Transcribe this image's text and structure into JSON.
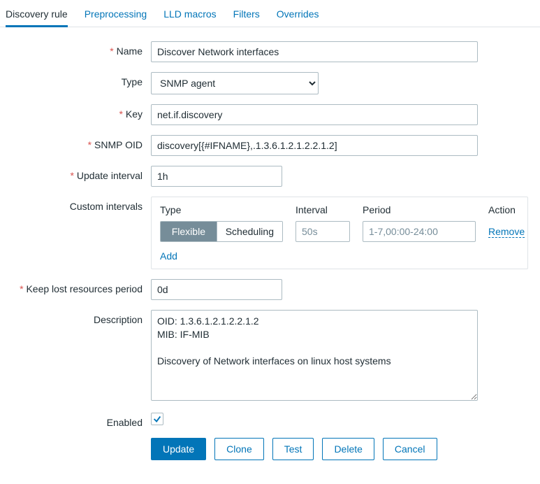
{
  "tabs": {
    "discovery_rule": "Discovery rule",
    "preprocessing": "Preprocessing",
    "lld_macros": "LLD macros",
    "filters": "Filters",
    "overrides": "Overrides"
  },
  "labels": {
    "name": "Name",
    "type": "Type",
    "key": "Key",
    "snmp_oid": "SNMP OID",
    "update_interval": "Update interval",
    "custom_intervals": "Custom intervals",
    "keep_lost": "Keep lost resources period",
    "description": "Description",
    "enabled": "Enabled"
  },
  "values": {
    "name": "Discover Network interfaces",
    "type": "SNMP agent",
    "key": "net.if.discovery",
    "snmp_oid": "discovery[{#IFNAME},.1.3.6.1.2.1.2.2.1.2]",
    "update_interval": "1h",
    "keep_lost": "0d",
    "description": "OID: 1.3.6.1.2.1.2.2.1.2\nMIB: IF-MIB\n\nDiscovery of Network interfaces on linux host systems",
    "enabled": true
  },
  "custom_intervals": {
    "head": {
      "type": "Type",
      "interval": "Interval",
      "period": "Period",
      "action": "Action"
    },
    "seg": {
      "flexible": "Flexible",
      "scheduling": "Scheduling"
    },
    "row": {
      "interval_placeholder": "50s",
      "period_placeholder": "1-7,00:00-24:00",
      "remove": "Remove"
    },
    "add": "Add"
  },
  "buttons": {
    "update": "Update",
    "clone": "Clone",
    "test": "Test",
    "delete": "Delete",
    "cancel": "Cancel"
  }
}
